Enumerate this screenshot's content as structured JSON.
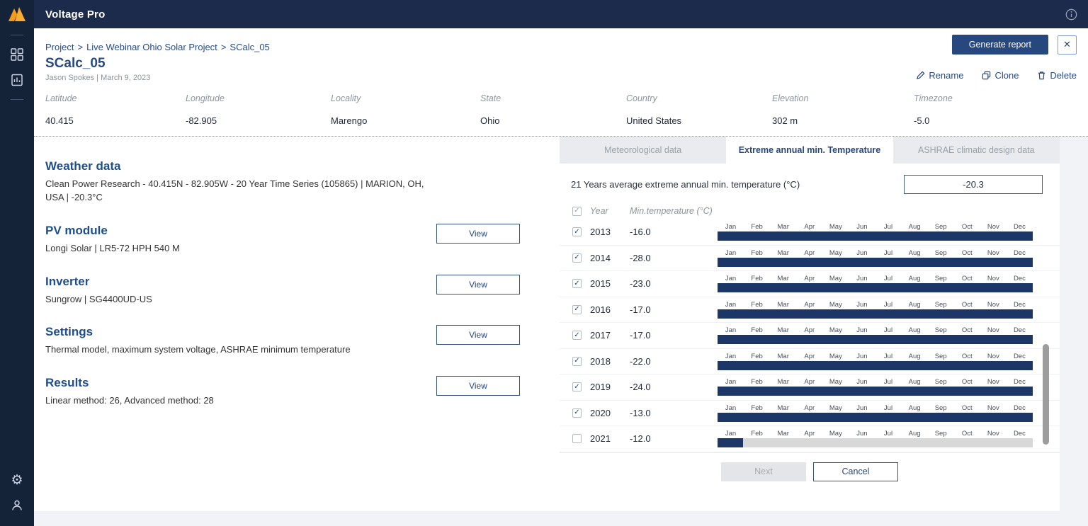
{
  "colors": {
    "topbar": "#1c2b4c",
    "sidebar": "#152339",
    "accent": "#27477f",
    "heading": "#1f4e8c",
    "bar_fill": "#1c3668",
    "bar_empty": "#d8d8d8",
    "logo_orange": "#f49b1d"
  },
  "icons": {
    "close": "✕",
    "check": "✓",
    "gear": "⚙"
  },
  "topbar": {
    "title": "Voltage Pro"
  },
  "breadcrumb": {
    "items": [
      "Project",
      "Live Webinar Ohio Solar Project",
      "SCalc_05"
    ],
    "separator": ">"
  },
  "header": {
    "title": "SCalc_05",
    "subtitle": "Jason Spokes | March 9, 2023",
    "generate_report_label": "Generate report",
    "actions": [
      {
        "id": "rename",
        "label": "Rename"
      },
      {
        "id": "clone",
        "label": "Clone"
      },
      {
        "id": "delete",
        "label": "Delete"
      }
    ]
  },
  "location_fields": [
    {
      "label": "Latitude",
      "value": "40.415"
    },
    {
      "label": "Longitude",
      "value": "-82.905"
    },
    {
      "label": "Locality",
      "value": "Marengo"
    },
    {
      "label": "State",
      "value": "Ohio"
    },
    {
      "label": "Country",
      "value": "United States"
    },
    {
      "label": "Elevation",
      "value": "302 m"
    },
    {
      "label": "Timezone",
      "value": "-5.0"
    }
  ],
  "sections": [
    {
      "title": "Weather data",
      "description": "Clean Power Research - 40.415N - 82.905W - 20 Year Time Series (105865) | MARION, OH, USA | -20.3°C",
      "view_label": null
    },
    {
      "title": "PV module",
      "description": "Longi Solar | LR5-72 HPH 540 M",
      "view_label": "View"
    },
    {
      "title": "Inverter",
      "description": "Sungrow | SG4400UD-US",
      "view_label": "View"
    },
    {
      "title": "Settings",
      "description": "Thermal model, maximum system voltage, ASHRAE minimum temperature",
      "view_label": "View"
    },
    {
      "title": "Results",
      "description": "Linear method: 26, Advanced method: 28",
      "view_label": "View"
    }
  ],
  "temperature_panel": {
    "tabs": [
      {
        "label": "Meteorological data",
        "active": false
      },
      {
        "label": "Extreme annual min. Temperature",
        "active": true
      },
      {
        "label": "ASHRAE climatic design data",
        "active": false
      }
    ],
    "average_label": "21 Years average extreme annual min. temperature (°C)",
    "average_value": "-20.3",
    "table": {
      "header": {
        "year": "Year",
        "min_temp": "Min.temperature (°C)",
        "header_checked": true
      },
      "months": [
        "Jan",
        "Feb",
        "Mar",
        "Apr",
        "May",
        "Jun",
        "Jul",
        "Aug",
        "Sep",
        "Oct",
        "Nov",
        "Dec"
      ],
      "rows": [
        {
          "year": "2013",
          "min_temp": "-16.0",
          "checked": true,
          "fill_pct": 100
        },
        {
          "year": "2014",
          "min_temp": "-28.0",
          "checked": true,
          "fill_pct": 100
        },
        {
          "year": "2015",
          "min_temp": "-23.0",
          "checked": true,
          "fill_pct": 100
        },
        {
          "year": "2016",
          "min_temp": "-17.0",
          "checked": true,
          "fill_pct": 100
        },
        {
          "year": "2017",
          "min_temp": "-17.0",
          "checked": true,
          "fill_pct": 100
        },
        {
          "year": "2018",
          "min_temp": "-22.0",
          "checked": true,
          "fill_pct": 100
        },
        {
          "year": "2019",
          "min_temp": "-24.0",
          "checked": true,
          "fill_pct": 100
        },
        {
          "year": "2020",
          "min_temp": "-13.0",
          "checked": true,
          "fill_pct": 100
        },
        {
          "year": "2021",
          "min_temp": "-12.0",
          "checked": false,
          "fill_pct": 8
        }
      ]
    },
    "next_label": "Next",
    "next_enabled": false,
    "cancel_label": "Cancel"
  }
}
